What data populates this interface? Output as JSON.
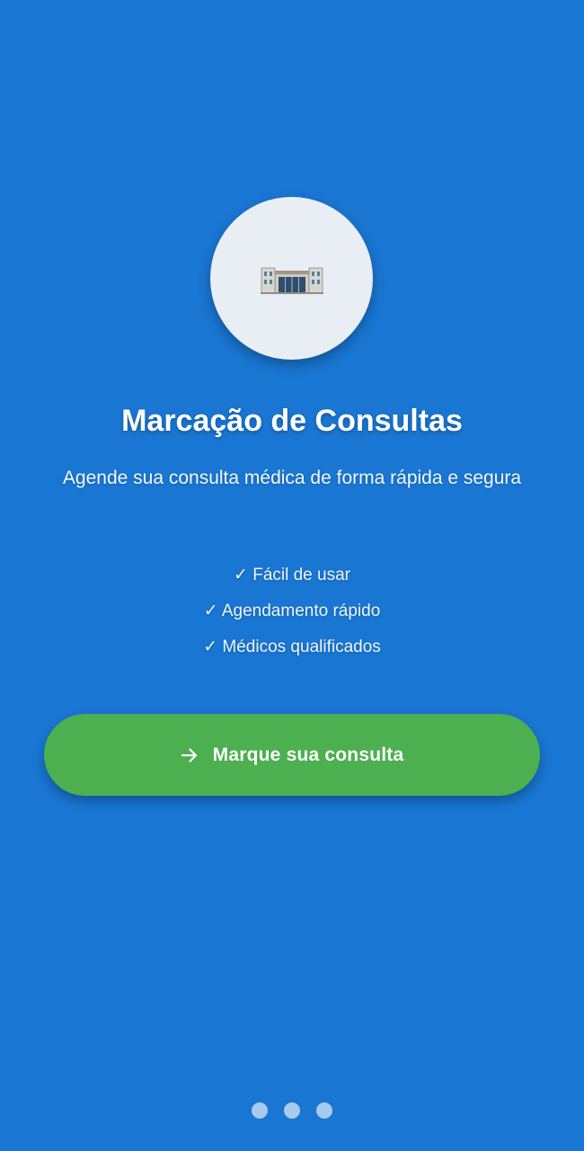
{
  "colors": {
    "background": "#1976D2",
    "icon_circle": "#E9EEF5",
    "cta_button": "#4CAF50",
    "text": "#FFFFFF",
    "dot": "#90BCEB"
  },
  "hero": {
    "icon": "hospital-building-icon"
  },
  "title": "Marcação de Consultas",
  "subtitle": "Agende sua consulta médica de forma rápida e segura",
  "features": [
    "✓ Fácil de usar",
    "✓ Agendamento rápido",
    "✓ Médicos qualificados"
  ],
  "cta": {
    "icon": "arrow-right-icon",
    "label": "Marque sua consulta"
  },
  "pagination": {
    "pages": 3,
    "icon": "page-indicator-dot"
  }
}
